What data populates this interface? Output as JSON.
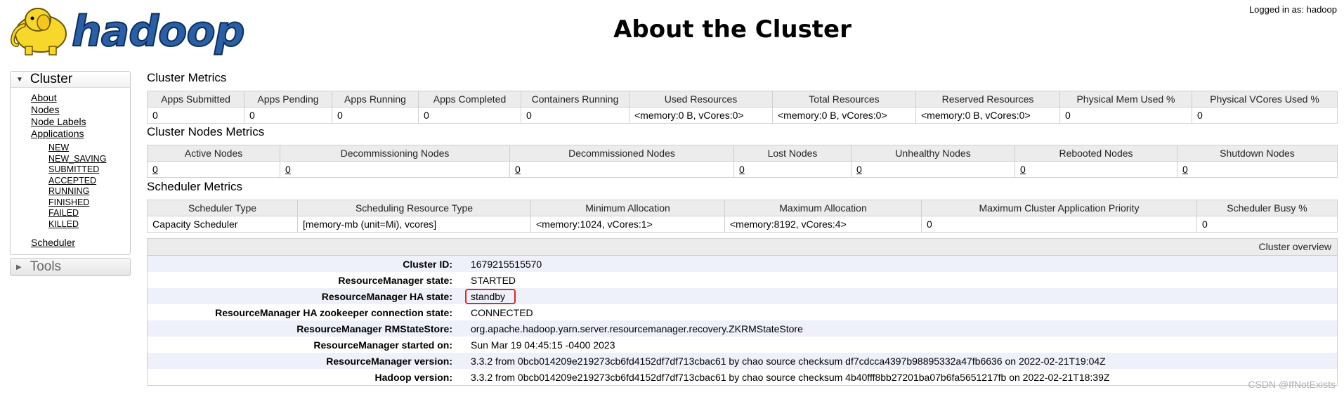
{
  "header": {
    "logo_text": "hadoop",
    "title": "About the Cluster",
    "logged_in": "Logged in as: hadoop"
  },
  "sidebar": {
    "cluster_label": "Cluster",
    "links": [
      "About",
      "Nodes",
      "Node Labels",
      "Applications"
    ],
    "app_states": [
      "NEW",
      "NEW_SAVING",
      "SUBMITTED",
      "ACCEPTED",
      "RUNNING",
      "FINISHED",
      "FAILED",
      "KILLED"
    ],
    "scheduler_link": "Scheduler",
    "tools_label": "Tools"
  },
  "cluster_metrics": {
    "title": "Cluster Metrics",
    "headers": [
      "Apps Submitted",
      "Apps Pending",
      "Apps Running",
      "Apps Completed",
      "Containers Running",
      "Used Resources",
      "Total Resources",
      "Reserved Resources",
      "Physical Mem Used %",
      "Physical VCores Used %"
    ],
    "values": [
      "0",
      "0",
      "0",
      "0",
      "0",
      "<memory:0 B, vCores:0>",
      "<memory:0 B, vCores:0>",
      "<memory:0 B, vCores:0>",
      "0",
      "0"
    ]
  },
  "node_metrics": {
    "title": "Cluster Nodes Metrics",
    "headers": [
      "Active Nodes",
      "Decommissioning Nodes",
      "Decommissioned Nodes",
      "Lost Nodes",
      "Unhealthy Nodes",
      "Rebooted Nodes",
      "Shutdown Nodes"
    ],
    "values": [
      "0",
      "0",
      "0",
      "0",
      "0",
      "0",
      "0"
    ]
  },
  "scheduler_metrics": {
    "title": "Scheduler Metrics",
    "headers": [
      "Scheduler Type",
      "Scheduling Resource Type",
      "Minimum Allocation",
      "Maximum Allocation",
      "Maximum Cluster Application Priority",
      "Scheduler Busy %"
    ],
    "values": [
      "Capacity Scheduler",
      "[memory-mb (unit=Mi), vcores]",
      "<memory:1024, vCores:1>",
      "<memory:8192, vCores:4>",
      "0",
      "0"
    ]
  },
  "overview": {
    "title": "Cluster overview",
    "rows": [
      {
        "label": "Cluster ID:",
        "value": "1679215515570"
      },
      {
        "label": "ResourceManager state:",
        "value": "STARTED"
      },
      {
        "label": "ResourceManager HA state:",
        "value": "standby"
      },
      {
        "label": "ResourceManager HA zookeeper connection state:",
        "value": "CONNECTED"
      },
      {
        "label": "ResourceManager RMStateStore:",
        "value": "org.apache.hadoop.yarn.server.resourcemanager.recovery.ZKRMStateStore"
      },
      {
        "label": "ResourceManager started on:",
        "value": "Sun Mar 19 04:45:15 -0400 2023"
      },
      {
        "label": "ResourceManager version:",
        "value": "3.3.2 from 0bcb014209e219273cb6fd4152df7df713cbac61 by chao source checksum df7cdcca4397b98895332a47fb6636 on 2022-02-21T19:04Z"
      },
      {
        "label": "Hadoop version:",
        "value": "3.3.2 from 0bcb014209e219273cb6fd4152df7df713cbac61 by chao source checksum 4b40fff8bb27201ba07b6fa5651217fb on 2022-02-21T18:39Z"
      }
    ]
  },
  "watermark": "CSDN @IfNotExists",
  "colors": {
    "highlight_border": "#e0262a",
    "logo_yellow": "#f7d82a",
    "logo_blue": "#2a5fa5"
  }
}
